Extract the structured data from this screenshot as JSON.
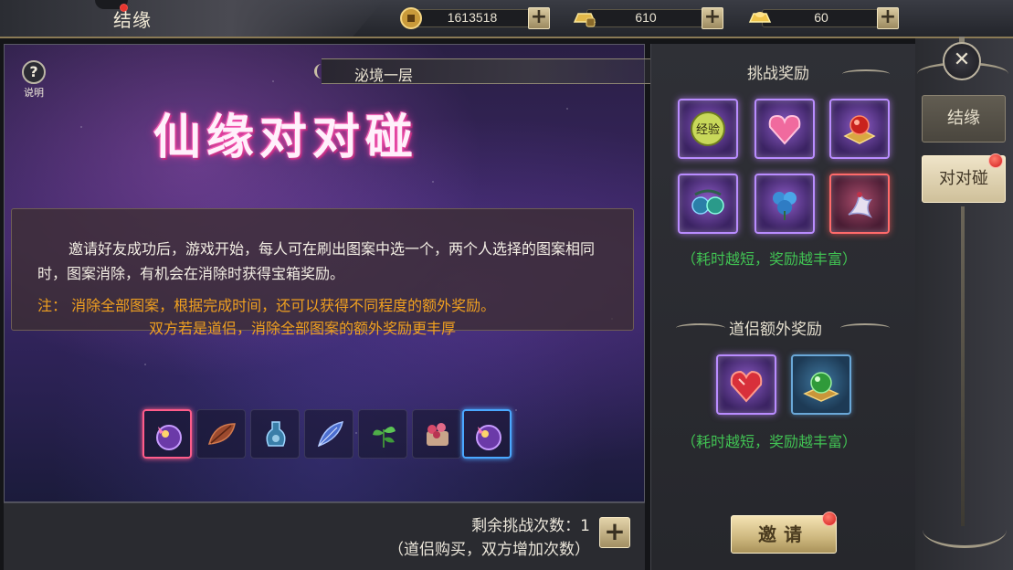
{
  "header": {
    "title": "结缘",
    "currencies": [
      {
        "name": "coin",
        "icon": "coin-icon",
        "value": "1613518"
      },
      {
        "name": "locked-ingot",
        "icon": "locked-ingot-icon",
        "value": "610"
      },
      {
        "name": "ingot",
        "icon": "gold-ingot-icon",
        "value": "60"
      }
    ]
  },
  "help": {
    "label": "说明",
    "icon": "question-icon"
  },
  "stage": {
    "floor_label": "泌境一层"
  },
  "game": {
    "title": "仙缘对对碰",
    "description": "邀请好友成功后，游戏开始，每人可在刷出图案中选一个，两个人选择的图案相同时，图案消除，有机会在消除时获得宝箱奖励。",
    "note_line1": "注：  消除全部图案，根据完成时间，还可以获得不同程度的额外奖励。",
    "note_line2": "双方若是道侣，消除全部图案的额外奖励更丰厚",
    "tiles": [
      {
        "icon": "magic-orb-icon",
        "highlight": "pink"
      },
      {
        "icon": "leaf-icon",
        "highlight": "none"
      },
      {
        "icon": "potion-icon",
        "highlight": "none"
      },
      {
        "icon": "feather-icon",
        "highlight": "none"
      },
      {
        "icon": "herb-icon",
        "highlight": "none"
      },
      {
        "icon": "flower-icon",
        "highlight": "none"
      },
      {
        "icon": "magic-orb-icon",
        "highlight": "blue"
      }
    ]
  },
  "challenge": {
    "remaining_label": "剩余挑战次数：1",
    "remaining_sub": "（道侣购买，双方增加次数）",
    "plus_label": "+"
  },
  "rewards": {
    "challenge_title": "挑战奖励",
    "challenge_items": [
      {
        "icon": "experience-icon",
        "label": "经验",
        "frame": "purple"
      },
      {
        "icon": "heart-icon",
        "frame": "purple"
      },
      {
        "icon": "red-pearl-icon",
        "frame": "purple"
      },
      {
        "icon": "jade-orbs-icon",
        "frame": "purple"
      },
      {
        "icon": "blue-flower-icon",
        "frame": "purple"
      },
      {
        "icon": "crane-spirit-icon",
        "frame": "red"
      }
    ],
    "challenge_note": "（耗时越短，奖励越丰富）",
    "couple_title": "道侣额外奖励",
    "couple_items": [
      {
        "icon": "red-heart-gem-icon",
        "frame": "purple"
      },
      {
        "icon": "green-orb-icon",
        "frame": "blue"
      }
    ],
    "couple_note": "（耗时越短，奖励越丰富）"
  },
  "invite": {
    "label": "邀请"
  },
  "side_tabs": [
    {
      "label": "结缘",
      "active": false
    },
    {
      "label": "对对碰",
      "active": true
    }
  ],
  "colors": {
    "note_orange": "#f0a020",
    "reward_green": "#41c253",
    "title_pink": "#ff5fb8",
    "alert_red": "#e8362f"
  }
}
